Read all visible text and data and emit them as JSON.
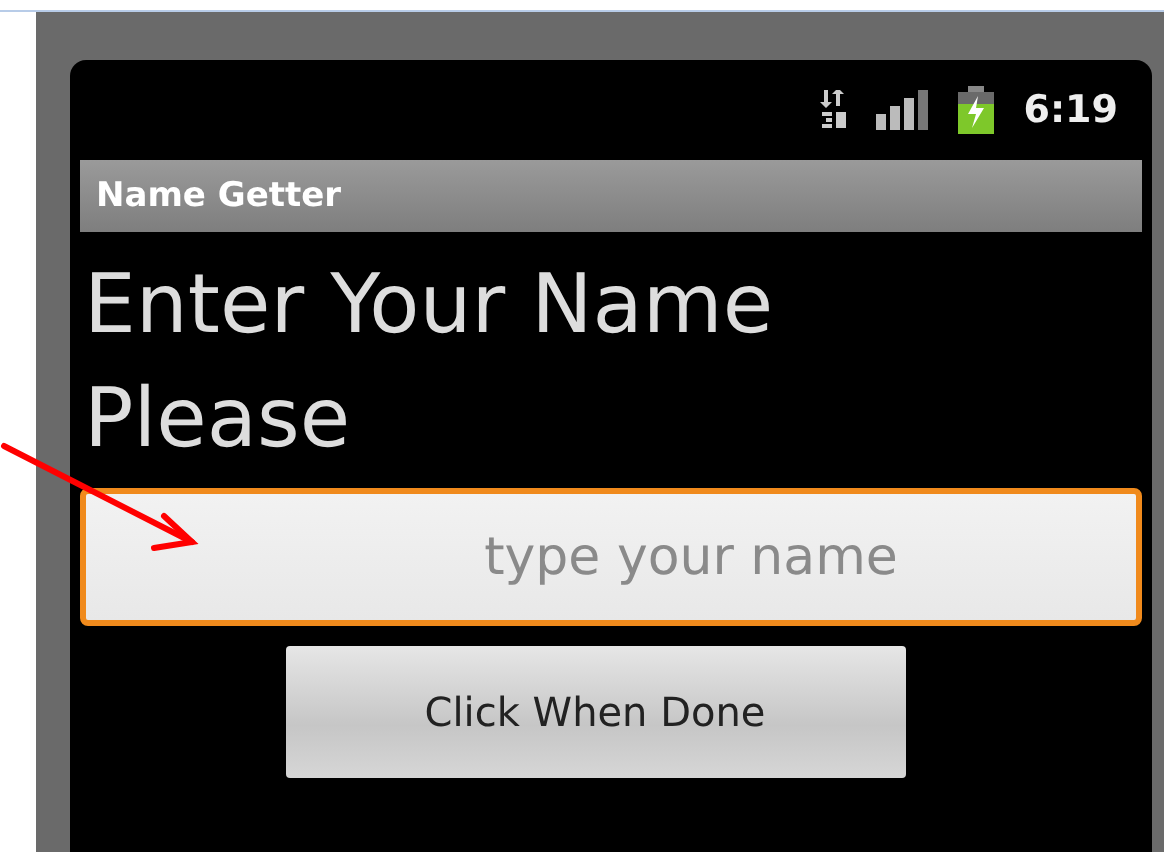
{
  "status_bar": {
    "time": "6:19"
  },
  "title_bar": {
    "title": "Name Getter"
  },
  "heading": "Enter Your Name Please",
  "name_field": {
    "placeholder": "type your name",
    "focused": true
  },
  "button": {
    "label": "Click When Done"
  },
  "annotation": {
    "kind": "arrow",
    "color": "#ff0000"
  }
}
